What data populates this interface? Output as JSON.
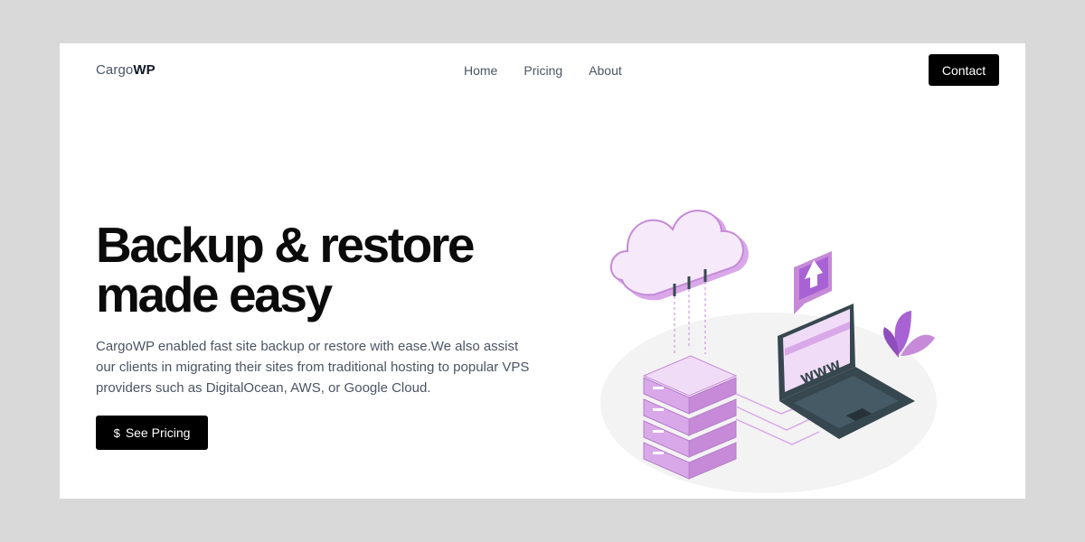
{
  "brand": {
    "prefix": "Cargo",
    "suffix": "WP"
  },
  "nav": {
    "items": [
      "Home",
      "Pricing",
      "About"
    ]
  },
  "header": {
    "contact_label": "Contact"
  },
  "hero": {
    "headline_line1": "Backup & restore",
    "headline_line2": "made easy",
    "description": "CargoWP enabled fast site backup or restore with ease.We also assist our clients in migrating their sites from traditional hosting to popular VPS providers such as DigitalOcean, AWS, or Google Cloud.",
    "cta_label": "See Pricing",
    "cta_icon": "dollar-sign-icon"
  },
  "illustration": {
    "screen_text": "WWW"
  },
  "colors": {
    "accent": "#a862d4",
    "accent_light": "#e6c5f0",
    "dark": "#37474f",
    "button_bg": "#000000",
    "page_bg": "#d9d9d9"
  }
}
